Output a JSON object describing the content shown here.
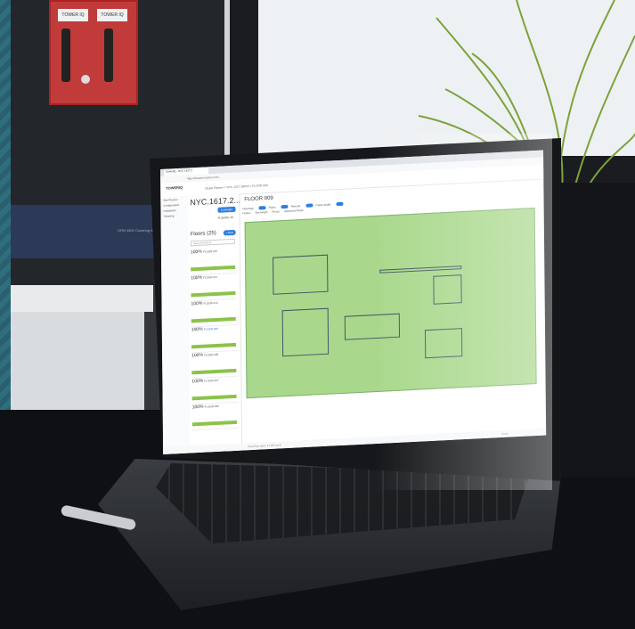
{
  "red_panel": {
    "label_left": "TOWER IQ",
    "label_right": "TOWER IQ"
  },
  "monitor": {
    "text_left": "",
    "text_right": "ORN 4802 Covering NYC'S Stroot"
  },
  "browser": {
    "tab_title": "TowerIQ - NYC.1617.2",
    "address": "https://towerio.ioulics.com/..."
  },
  "app": {
    "logo": "TOWERIQ",
    "breadcrumb": "Dispel Planner  >  NYC.1617.2B0X3  >  FLOOR 009",
    "sidebar_items": [
      "Site Planner",
      "Configuration",
      "Installation",
      "Ticketing"
    ],
    "site_title": "NYC.1617.2...",
    "coverage_button": "Coverage",
    "floor_code": "FLOORS: 25",
    "floors_heading": "Floors (25)",
    "new_button": "+ New",
    "search_placeholder": "Search for floor",
    "floors": [
      {
        "pct": "100%",
        "name": "FLOOR 010"
      },
      {
        "pct": "100%",
        "name": "FLOOR 011"
      },
      {
        "pct": "100%",
        "name": "FLOOR 010"
      },
      {
        "pct": "100%",
        "name": "FLOOR 009"
      },
      {
        "pct": "100%",
        "name": "FLOOR 008"
      },
      {
        "pct": "100%",
        "name": "FLOOR 007"
      },
      {
        "pct": "100%",
        "name": "FLOOR 006"
      }
    ],
    "floor_title": "FLOOR 009",
    "toolbar_labels": [
      "Heatmap",
      "Radio",
      "Remote",
      "Cable length",
      "Nodes",
      "Site length",
      "Floors",
      "Advanced Mode"
    ],
    "status_left": "Total floor area: 71,926 sq ft",
    "status_right": "Scale"
  },
  "colors": {
    "accent": "#2f7de1",
    "coverage_green": "#a9d88c",
    "panel_red": "#c23b3b"
  }
}
